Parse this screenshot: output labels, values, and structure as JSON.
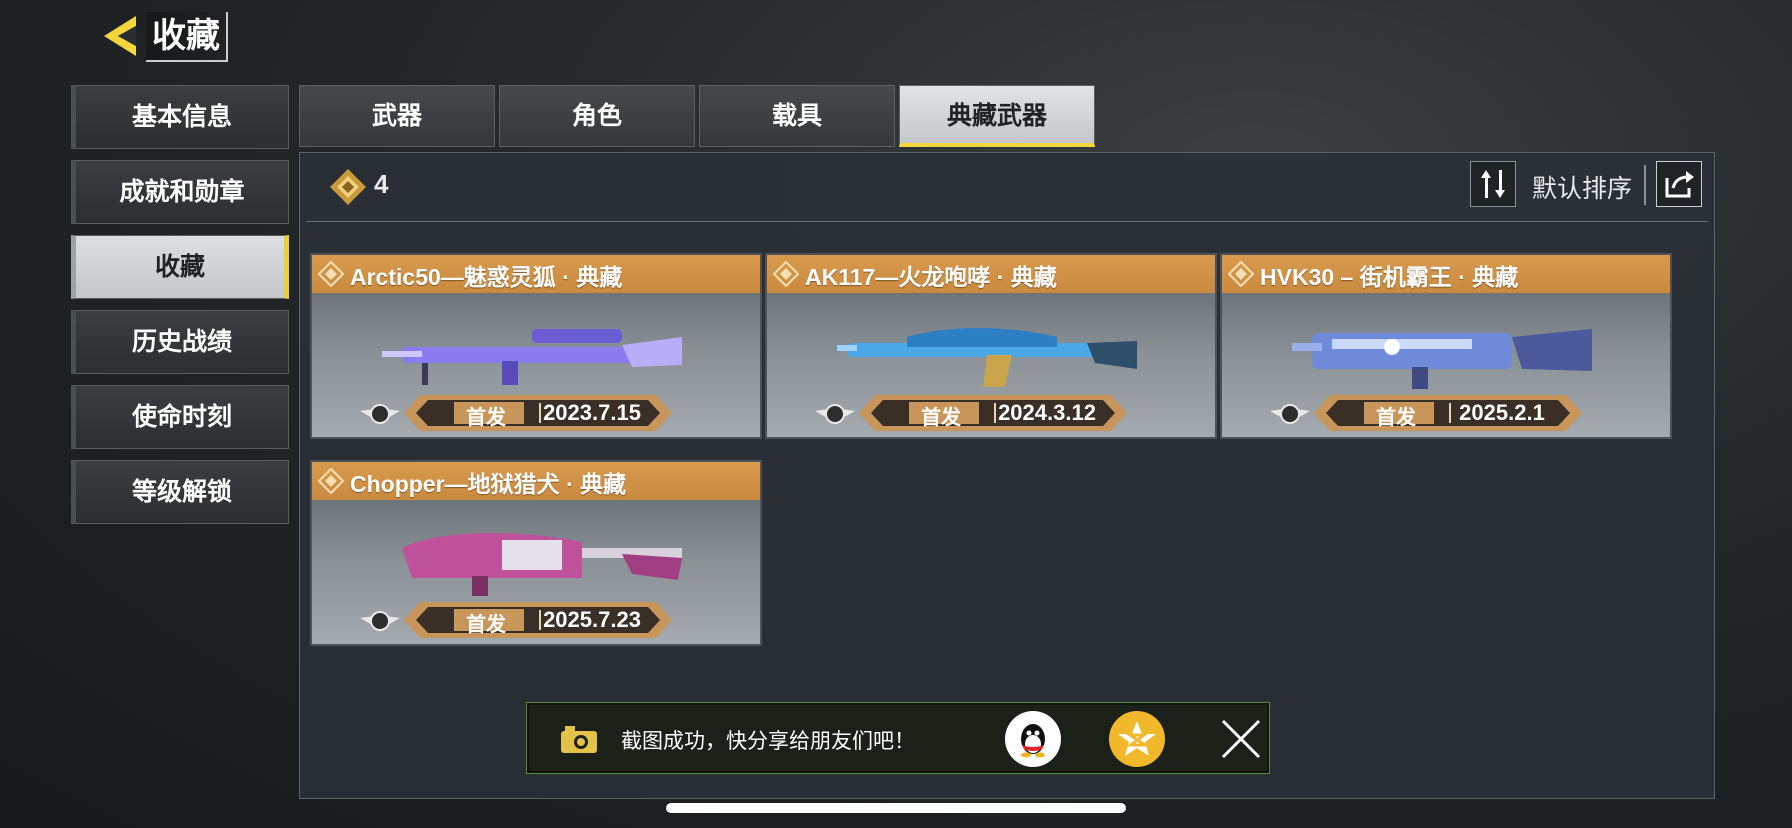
{
  "header": {
    "title": "收藏"
  },
  "sidebar": {
    "items": [
      {
        "label": "基本信息",
        "active": false
      },
      {
        "label": "成就和勋章",
        "active": false
      },
      {
        "label": "收藏",
        "active": true
      },
      {
        "label": "历史战绩",
        "active": false
      },
      {
        "label": "使命时刻",
        "active": false
      },
      {
        "label": "等级解锁",
        "active": false
      }
    ]
  },
  "tabs": [
    {
      "label": "武器",
      "active": false
    },
    {
      "label": "角色",
      "active": false
    },
    {
      "label": "载具",
      "active": false
    },
    {
      "label": "典藏武器",
      "active": true
    }
  ],
  "panel": {
    "count": "4",
    "sort_label": "默认排序",
    "cards": [
      {
        "name": "Arctic50—魅惑灵狐 · 典藏",
        "tag": "首发",
        "date": "2023.7.15",
        "gun_color": "#8b7cf0"
      },
      {
        "name": "AK117—火龙咆哮 · 典藏",
        "tag": "首发",
        "date": "2024.3.12",
        "gun_color": "#4aa8e8"
      },
      {
        "name": "HVK30 – 街机霸王 · 典藏",
        "tag": "首发",
        "date": "2025.2.1",
        "gun_color": "#6f8ad8"
      },
      {
        "name": "Chopper—地狱猎犬 · 典藏",
        "tag": "首发",
        "date": "2025.7.23",
        "gun_color": "#c0529c"
      }
    ]
  },
  "toast": {
    "text": "截图成功，快分享给朋友们吧！"
  },
  "colors": {
    "accent_yellow": "#f2d63a",
    "card_header": "#d99a4e",
    "toast_border": "#5f8a2c"
  }
}
